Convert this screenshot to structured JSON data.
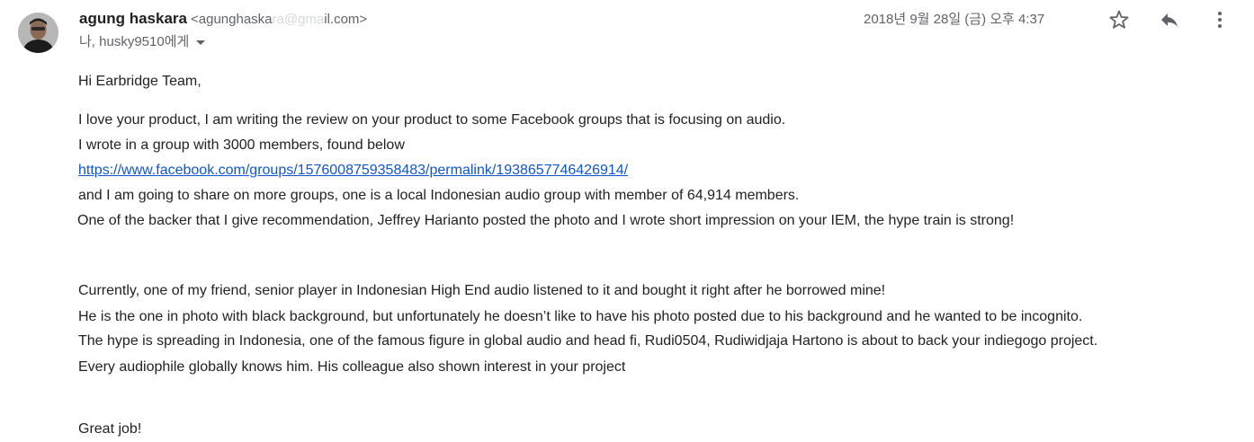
{
  "header": {
    "sender_name": "agung haskara",
    "sender_email_prefix": "<agunghaska",
    "sender_email_obscured": "ra@gma",
    "sender_email_suffix": "il.com>",
    "recipients": "나, husky9510에게",
    "date": "2018년 9월 28일 (금) 오후 4:37",
    "icons": [
      "star-icon",
      "reply-icon",
      "more-vert-icon"
    ]
  },
  "message": {
    "greeting": "Hi Earbridge Team,",
    "para1": [
      "I love your product, I am writing the review on your product to some Facebook groups that is focusing on audio.",
      "I wrote in a group with 3000 members, found below",
      "https://www.facebook.com/groups/1576008759358483/permalink/1938657746426914/",
      "and I am going to share on more groups, one is a local Indonesian audio group with member of 64,914 members.",
      "One of the backer that I give recommendation, Jeffrey Harianto posted the photo and I wrote short impression on your IEM, the hype train is strong!"
    ],
    "para2": [
      "Currently, one of my friend, senior player in Indonesian High End audio listened to it and bought it right after he borrowed mine!",
      "He is the one in photo with black background, but unfortunately he doesn’t like to have his photo posted due to his background and he wanted to be incognito.",
      "The hype is spreading in Indonesia, one of the famous figure in global audio and head fi, Rudi0504, Rudiwidjaja Hartono is about to back your indiegogo project.",
      "Every audiophile globally knows him. His colleague also shown interest in your project"
    ],
    "closing": "Great job!"
  },
  "colors": {
    "link": "#1155cc",
    "secondary_text": "#5f6368",
    "body_text": "#222222"
  }
}
